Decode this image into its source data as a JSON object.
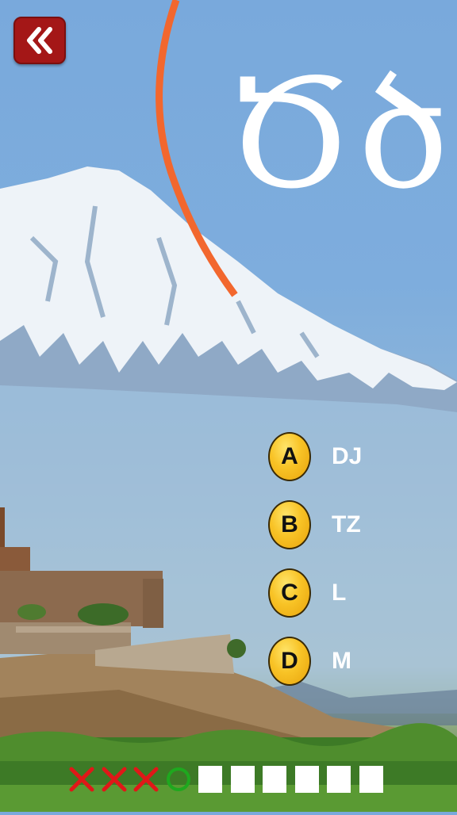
{
  "question": {
    "letter": "Ծծ"
  },
  "options": [
    {
      "badge": "A",
      "label": "DJ"
    },
    {
      "badge": "B",
      "label": "TZ"
    },
    {
      "badge": "C",
      "label": "L"
    },
    {
      "badge": "D",
      "label": "M"
    }
  ],
  "progress": [
    "wrong",
    "wrong",
    "wrong",
    "correct",
    "empty",
    "empty",
    "empty",
    "empty",
    "empty",
    "empty"
  ],
  "colors": {
    "back_button": "#a41717",
    "timer_arc": "#f2672e",
    "badge": "#f8c326",
    "wrong_mark": "#e01818",
    "correct_mark": "#1ea81e"
  },
  "icons": {
    "back": "double-chevron-left-icon"
  }
}
